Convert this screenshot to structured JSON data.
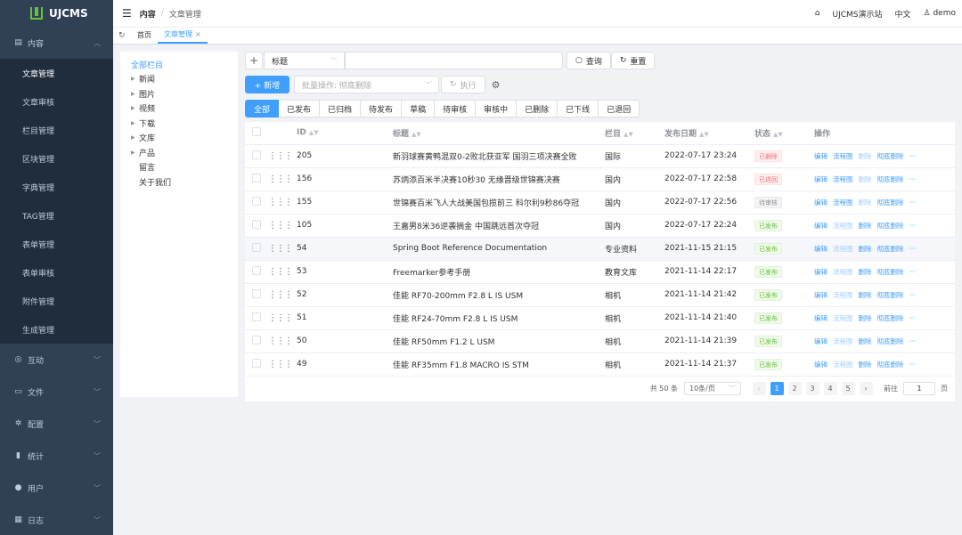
{
  "app": {
    "name": "UJCMS"
  },
  "sidebar": {
    "groups": [
      {
        "label": "内容",
        "icon": "document-icon",
        "expanded": true
      },
      {
        "label": "互动",
        "icon": "chat-icon"
      },
      {
        "label": "文件",
        "icon": "folder-icon"
      },
      {
        "label": "配置",
        "icon": "gear-icon"
      },
      {
        "label": "统计",
        "icon": "bar-chart-icon"
      },
      {
        "label": "用户",
        "icon": "user-icon"
      },
      {
        "label": "日志",
        "icon": "log-icon"
      }
    ],
    "content_items": [
      "文章管理",
      "文章审核",
      "栏目管理",
      "区块管理",
      "字典管理",
      "TAG管理",
      "表单管理",
      "表单审核",
      "附件管理",
      "生成管理"
    ]
  },
  "topbar": {
    "breadcrumb_root": "内容",
    "breadcrumb_sep": "/",
    "breadcrumb_current": "文章管理",
    "site": "UJCMS演示站",
    "lang": "中文",
    "user": "demo"
  },
  "tabs": {
    "home": "首页",
    "current": "文章管理",
    "close": "×"
  },
  "tree": {
    "root": "全部栏目",
    "nodes": [
      {
        "label": "新闻",
        "has_children": true
      },
      {
        "label": "图片",
        "has_children": true
      },
      {
        "label": "视频",
        "has_children": true
      },
      {
        "label": "下载",
        "has_children": true
      },
      {
        "label": "文库",
        "has_children": true
      },
      {
        "label": "产品",
        "has_children": true
      },
      {
        "label": "留言",
        "has_children": false
      },
      {
        "label": "关于我们",
        "has_children": false
      }
    ]
  },
  "toolbar": {
    "plus": "+",
    "search_field": "标题",
    "search_value": "",
    "query": "查询",
    "reset": "重置",
    "add": "+ 新增",
    "batch_label": "批量操作: 彻底删除",
    "execute": "执行"
  },
  "status_tabs": [
    "全部",
    "已发布",
    "已归档",
    "待发布",
    "草稿",
    "待审核",
    "审核中",
    "已删除",
    "已下线",
    "已退回"
  ],
  "table": {
    "headers": {
      "id": "ID",
      "title": "标题",
      "channel": "栏目",
      "date": "发布日期",
      "status": "状态",
      "ops": "操作"
    },
    "rows": [
      {
        "id": "205",
        "title": "新羽球赛黄鸭混双0-2败北获亚军 国羽三项决赛全败",
        "channel": "国际",
        "date": "2022-07-17 23:24",
        "status": "已删除",
        "status_type": "deleted"
      },
      {
        "id": "156",
        "title": "苏炳添百米半决赛10秒30 无缘晋级世锦赛决赛",
        "channel": "国内",
        "date": "2022-07-17 22:58",
        "status": "已退回",
        "status_type": "returned"
      },
      {
        "id": "155",
        "title": "世锦赛百米飞人大战美国包揽前三 科尔利9秒86夺冠",
        "channel": "国内",
        "date": "2022-07-17 22:56",
        "status": "待审核",
        "status_type": "pending"
      },
      {
        "id": "105",
        "title": "王嘉男8米36逆袭摘金 中国跳远首次夺冠",
        "channel": "国内",
        "date": "2022-07-17 22:24",
        "status": "已发布",
        "status_type": "published"
      },
      {
        "id": "54",
        "title": "Spring Boot Reference Documentation",
        "channel": "专业资料",
        "date": "2021-11-15 21:15",
        "status": "已发布",
        "status_type": "published"
      },
      {
        "id": "53",
        "title": "Freemarker参考手册",
        "channel": "教育文库",
        "date": "2021-11-14 22:17",
        "status": "已发布",
        "status_type": "published"
      },
      {
        "id": "52",
        "title": "佳能 RF70-200mm F2.8 L IS USM",
        "channel": "相机",
        "date": "2021-11-14 21:42",
        "status": "已发布",
        "status_type": "published"
      },
      {
        "id": "51",
        "title": "佳能 RF24-70mm F2.8 L IS USM",
        "channel": "相机",
        "date": "2021-11-14 21:40",
        "status": "已发布",
        "status_type": "published"
      },
      {
        "id": "50",
        "title": "佳能 RF50mm F1.2 L USM",
        "channel": "相机",
        "date": "2021-11-14 21:39",
        "status": "已发布",
        "status_type": "published"
      },
      {
        "id": "49",
        "title": "佳能 RF35mm F1.8 MACRO IS STM",
        "channel": "相机",
        "date": "2021-11-14 21:37",
        "status": "已发布",
        "status_type": "published"
      }
    ],
    "ops": [
      "编辑",
      "流程图",
      "删除",
      "彻底删除",
      "···"
    ]
  },
  "pagination": {
    "total": "共 50 条",
    "page_size": "10条/页",
    "prev": "‹",
    "next": "›",
    "pages": [
      "1",
      "2",
      "3",
      "4",
      "5"
    ],
    "current": "1",
    "goto_label": "前往",
    "goto_value": "1",
    "goto_suffix": "页"
  },
  "colors": {
    "primary": "#409eff",
    "sidebar_bg": "#304156",
    "success": "#67c23a",
    "danger": "#f56c6c"
  }
}
